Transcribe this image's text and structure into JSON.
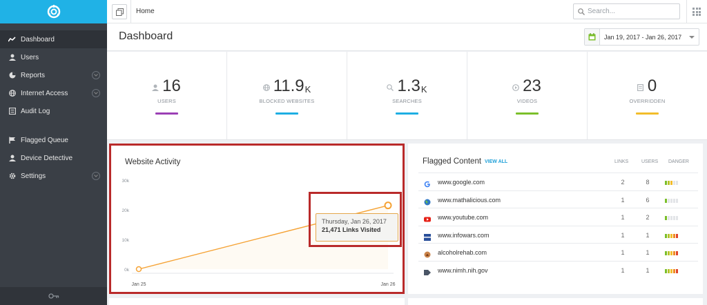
{
  "sidebar": {
    "items": [
      {
        "label": "Dashboard",
        "icon": "activity-icon"
      },
      {
        "label": "Users",
        "icon": "user-icon"
      },
      {
        "label": "Reports",
        "icon": "pie-chart-icon"
      },
      {
        "label": "Internet Access",
        "icon": "globe-icon"
      },
      {
        "label": "Audit Log",
        "icon": "list-icon"
      },
      {
        "label": "Flagged Queue",
        "icon": "flag-icon"
      },
      {
        "label": "Device Detective",
        "icon": "user-icon"
      },
      {
        "label": "Settings",
        "icon": "gear-icon"
      }
    ]
  },
  "topbar": {
    "breadcrumb": "Home",
    "search_placeholder": "Search..."
  },
  "header": {
    "title": "Dashboard",
    "date_range": "Jan 19, 2017 - Jan 26, 2017"
  },
  "stats": [
    {
      "value": "16",
      "suffix": "",
      "label": "USERS",
      "color": "#9b3fb5",
      "icon": "user-icon"
    },
    {
      "value": "11.9",
      "suffix": "K",
      "label": "BLOCKED WEBSITES",
      "color": "#1eaee3",
      "icon": "globe-icon"
    },
    {
      "value": "1.3",
      "suffix": "K",
      "label": "SEARCHES",
      "color": "#1eaee3",
      "icon": "search-icon"
    },
    {
      "value": "23",
      "suffix": "",
      "label": "VIDEOS",
      "color": "#7bbf2a",
      "icon": "play-icon"
    },
    {
      "value": "0",
      "suffix": "",
      "label": "OVERRIDDEN",
      "color": "#f2bd2a",
      "icon": "document-icon"
    }
  ],
  "activity": {
    "title": "Website Activity",
    "tooltip_date": "Thursday, Jan 26, 2017",
    "tooltip_value": "21,471 Links Visited"
  },
  "chart_data": {
    "type": "area",
    "title": "Website Activity",
    "x": [
      "Jan 25",
      "Jan 26"
    ],
    "values": [
      0,
      21471
    ],
    "yticks": [
      "0k",
      "10k",
      "20k",
      "30k"
    ],
    "ylim": [
      0,
      30000
    ],
    "grid": false,
    "color": "#f5a234"
  },
  "flagged": {
    "title": "Flagged Content",
    "view_all": "VIEW ALL",
    "col_links": "LINKS",
    "col_users": "USERS",
    "col_danger": "DANGER",
    "rows": [
      {
        "site": "www.google.com",
        "links": "2",
        "users": "8",
        "icon": "google-icon",
        "danger": 3
      },
      {
        "site": "www.mathalicious.com",
        "links": "1",
        "users": "6",
        "icon": "globe-icon",
        "danger": 1
      },
      {
        "site": "www.youtube.com",
        "links": "1",
        "users": "2",
        "icon": "youtube-icon",
        "danger": 1
      },
      {
        "site": "www.infowars.com",
        "links": "1",
        "users": "1",
        "icon": "infowars-icon",
        "danger": 5
      },
      {
        "site": "alcoholrehab.com",
        "links": "1",
        "users": "1",
        "icon": "rehab-icon",
        "danger": 5
      },
      {
        "site": "www.nimh.nih.gov",
        "links": "1",
        "users": "1",
        "icon": "nih-icon",
        "danger": 5
      }
    ]
  }
}
